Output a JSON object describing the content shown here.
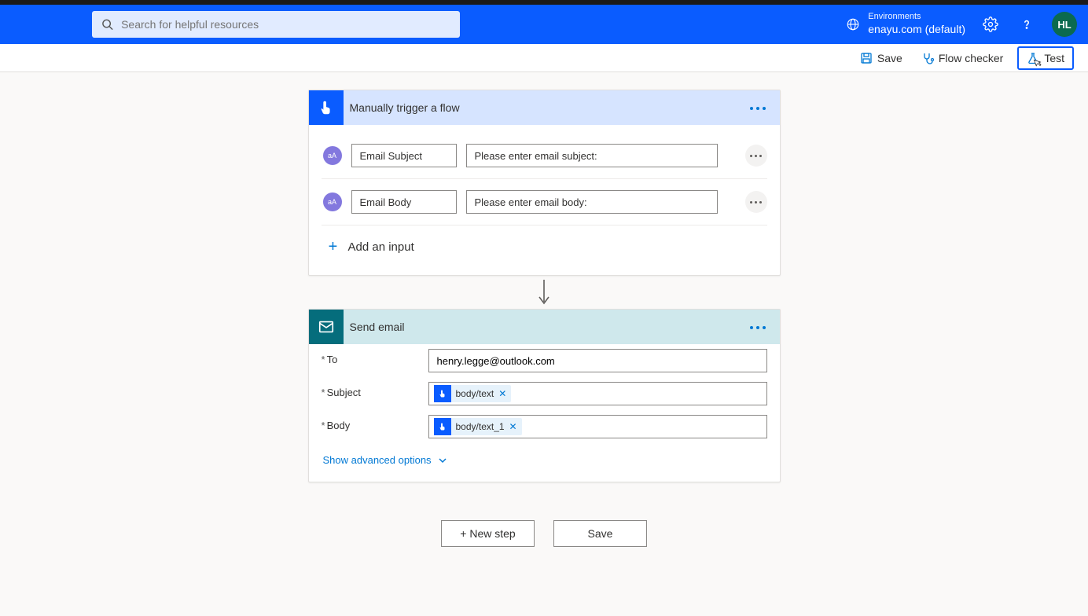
{
  "header": {
    "search_placeholder": "Search for helpful resources",
    "env_label": "Environments",
    "env_value": "enayu.com (default)",
    "avatar_initials": "HL"
  },
  "toolbar": {
    "save": "Save",
    "flow_checker": "Flow checker",
    "test": "Test"
  },
  "trigger_card": {
    "title": "Manually trigger a flow",
    "param_badge": "aA",
    "inputs": [
      {
        "name": "Email Subject",
        "prompt": "Please enter email subject:"
      },
      {
        "name": "Email Body",
        "prompt": "Please enter email body:"
      }
    ],
    "add_input": "Add an input"
  },
  "email_card": {
    "title": "Send email",
    "fields": {
      "to_label": "To",
      "to_value": "henry.legge@outlook.com",
      "subject_label": "Subject",
      "subject_token": "body/text",
      "body_label": "Body",
      "body_token": "body/text_1"
    },
    "advanced": "Show advanced options"
  },
  "buttons": {
    "new_step": "+ New step",
    "save": "Save"
  }
}
